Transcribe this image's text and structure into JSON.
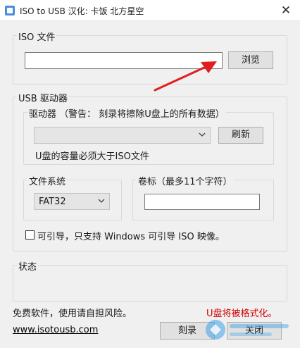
{
  "window": {
    "title": "ISO to USB  汉化: 卡饭 北方星空",
    "close_glyph": "✕"
  },
  "iso_group": {
    "label": "ISO 文件",
    "path_value": "",
    "browse_label": "浏览"
  },
  "usb_group": {
    "label": "USB 驱动器",
    "drive_group_label": "驱动器 （警告： 刻录将擦除U盘上的所有数据）",
    "drive_value": "",
    "refresh_label": "刷新",
    "capacity_note": "U盘的容量必须大于ISO文件",
    "fs_group_label": "文件系统",
    "fs_value": "FAT32",
    "volume_group_label": "卷标（最多11个字符）",
    "volume_value": ""
  },
  "bootable": {
    "checked": false,
    "label": "可引导，只支持 Windows 可引导 ISO 映像。"
  },
  "status_group": {
    "label": "状态"
  },
  "footer": {
    "disclaimer": "免费软件，使用请自担风险。",
    "format_warning": "U盘将被格式化。",
    "website": "www.isotousb.com",
    "burn_label": "刻录",
    "close_label": "关闭"
  },
  "colors": {
    "warning": "#d40000",
    "annotation_arrow": "#e02020"
  }
}
